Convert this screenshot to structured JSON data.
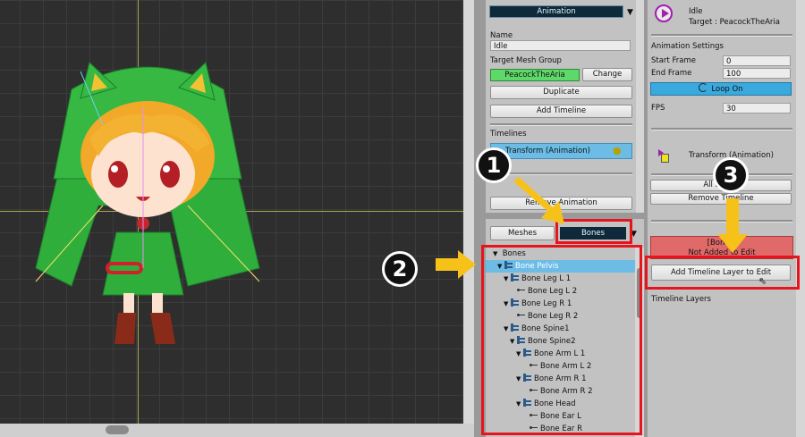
{
  "top_panel": {
    "dropdown": "Animation",
    "name_label": "Name",
    "name_value": "Idle",
    "mesh_group_label": "Target Mesh Group",
    "mesh_group_value": "PeacockTheAria",
    "change_btn": "Change",
    "duplicate_btn": "Duplicate",
    "add_timeline_btn": "Add Timeline",
    "timelines_label": "Timelines",
    "timeline_item": "Transform (Animation)",
    "remove_animation_btn": "Remove Animation"
  },
  "tabs": {
    "meshes": "Meshes",
    "bones": "Bones"
  },
  "tree": {
    "root": "Bones",
    "items": [
      {
        "label": "Bone Pelvis",
        "depth": 1,
        "expand": true,
        "selected": true
      },
      {
        "label": "Bone Leg L 1",
        "depth": 2,
        "expand": true
      },
      {
        "label": "Bone Leg L 2",
        "depth": 3,
        "expand": false
      },
      {
        "label": "Bone Leg R 1",
        "depth": 2,
        "expand": true
      },
      {
        "label": "Bone Leg R 2",
        "depth": 3,
        "expand": false
      },
      {
        "label": "Bone Spine1",
        "depth": 2,
        "expand": true
      },
      {
        "label": "Bone Spine2",
        "depth": 3,
        "expand": true
      },
      {
        "label": "Bone Arm L 1",
        "depth": 4,
        "expand": true
      },
      {
        "label": "Bone Arm L 2",
        "depth": 5,
        "expand": false
      },
      {
        "label": "Bone Arm R 1",
        "depth": 4,
        "expand": true
      },
      {
        "label": "Bone Arm R 2",
        "depth": 5,
        "expand": false
      },
      {
        "label": "Bone Head",
        "depth": 4,
        "expand": true
      },
      {
        "label": "Bone Ear L",
        "depth": 5,
        "expand": false
      },
      {
        "label": "Bone Ear R",
        "depth": 5,
        "expand": false
      }
    ]
  },
  "right_panel": {
    "anim_name": "Idle",
    "anim_target": "Target : PeacockTheAria",
    "settings_label": "Animation Settings",
    "start_frame_label": "Start Frame",
    "start_frame_value": "0",
    "end_frame_label": "End Frame",
    "end_frame_value": "100",
    "loop_btn": "Loop On",
    "fps_label": "FPS",
    "fps_value": "30",
    "timeline_title": "Transform (Animation)",
    "all_btn": "All Bones",
    "remove_timeline_btn": "Remove Timeline",
    "warning_line1": "[Bones]",
    "warning_line2": "Not Added to Edit",
    "add_layer_btn": "Add Timeline Layer to Edit",
    "layers_label": "Timeline Layers"
  },
  "callouts": [
    "1",
    "2",
    "3"
  ],
  "colors": {
    "accent_green": "#5fd86a",
    "selected_blue": "#6cbce6",
    "loop_blue": "#3aa9dd",
    "highlight_red": "#e8141c",
    "arrow_yellow": "#f6c21a",
    "warning_red": "#e06a6a",
    "dropdown_dark": "#0e2a3a"
  }
}
